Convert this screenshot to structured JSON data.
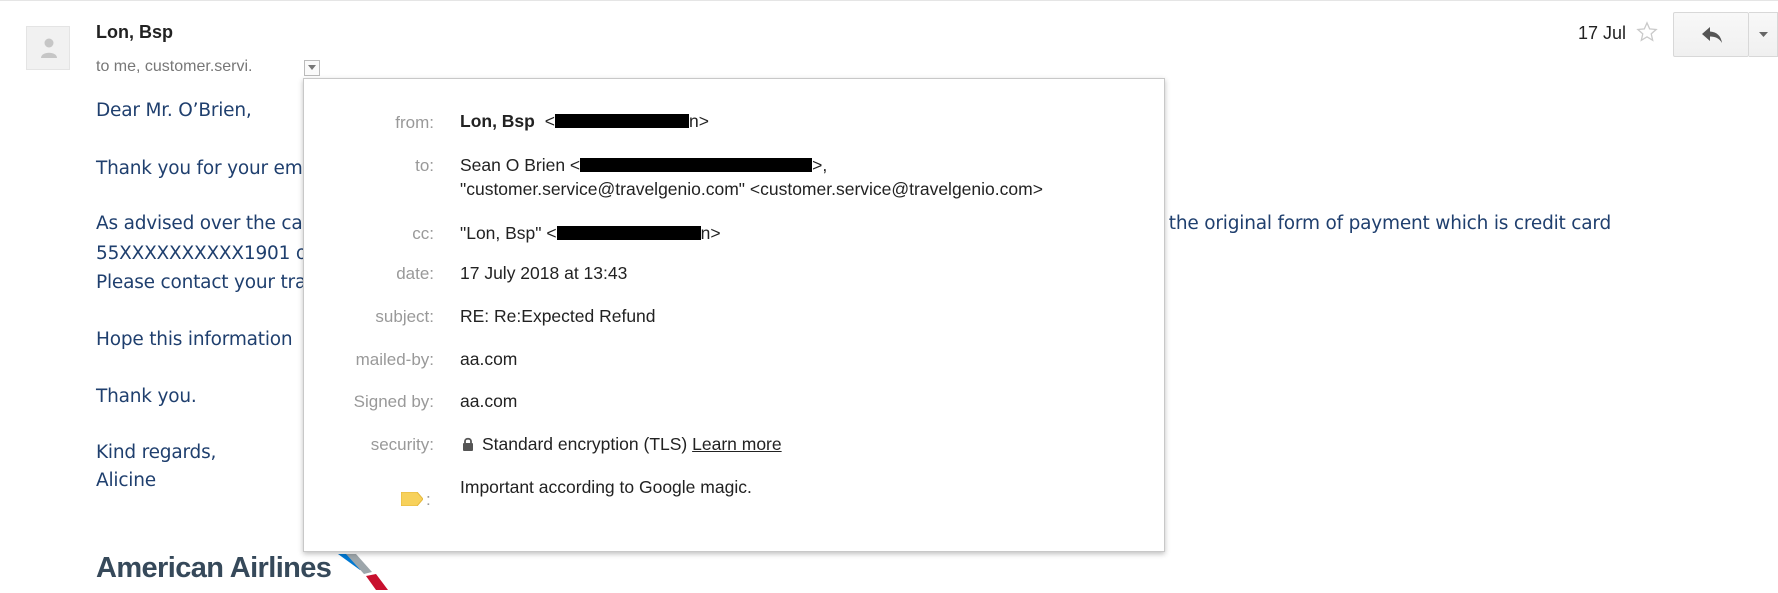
{
  "header": {
    "sender_name": "Lon, Bsp",
    "recipients": "to me, customer.servi.",
    "date_short": "17 Jul"
  },
  "body": {
    "greeting": "Dear Mr. O’Brien,",
    "line1_start": "Thank you for your em",
    "line2_start": "As advised over the ca",
    "line2_end": "o the original form of payment which is credit card",
    "line3_start": "55XXXXXXXXXX1901 o",
    "line4_start": "Please contact your tra",
    "line5_start": "Hope this information",
    "thanks": "Thank you.",
    "closing": "Kind regards,",
    "signature": "Alicine",
    "logo_text": "American Airlines"
  },
  "details": {
    "from": {
      "label": "from:",
      "name": "Lon, Bsp",
      "email_open": "<",
      "email_close": "n>"
    },
    "to": {
      "label": "to:",
      "line1_name": "Sean O Brien <",
      "line1_close": ">,",
      "line2": "\"customer.service@travelgenio.com\" <customer.service@travelgenio.com>"
    },
    "cc": {
      "label": "cc:",
      "name": "\"Lon, Bsp\" <",
      "email_close": "n>"
    },
    "date": {
      "label": "date:",
      "value": "17 July 2018 at 13:43"
    },
    "subject": {
      "label": "subject:",
      "value": "RE: Re:Expected Refund"
    },
    "mailed_by": {
      "label": "mailed-by:",
      "value": "aa.com"
    },
    "signed_by": {
      "label": "Signed by:",
      "value": "aa.com"
    },
    "security": {
      "label": "security:",
      "value": "Standard encryption (TLS)",
      "link": "Learn more"
    },
    "importance": {
      "colon": ":",
      "value": "Important according to Google magic."
    }
  },
  "icons": {
    "avatar": "person-icon",
    "toggle": "chevron-down-icon",
    "star": "star-icon",
    "reply": "reply-icon",
    "more": "chevron-down-icon",
    "security": "lock-icon",
    "importance": "importance-marker-icon"
  },
  "colors": {
    "body_text": "#1f3f6e",
    "label_grey": "#999999",
    "importance_marker": "#f7d15b",
    "logo_red": "#c8102e",
    "logo_blue": "#0078d2"
  }
}
